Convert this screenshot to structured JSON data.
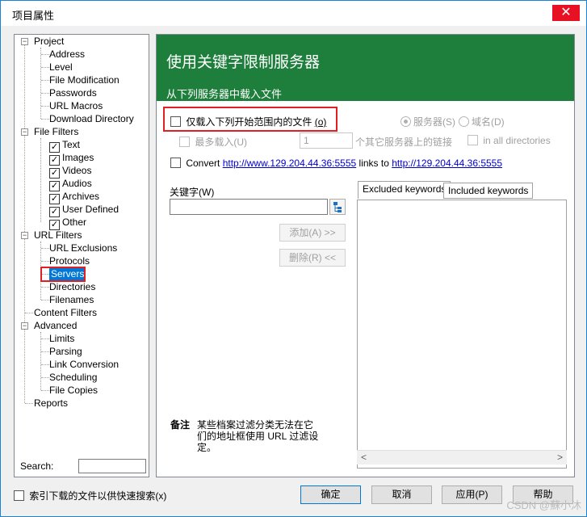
{
  "window": {
    "title": "项目属性",
    "close_glyph": "✕"
  },
  "tree": {
    "items": [
      {
        "label": "Project"
      },
      {
        "label": "Address"
      },
      {
        "label": "Level"
      },
      {
        "label": "File Modification"
      },
      {
        "label": "Passwords"
      },
      {
        "label": "URL Macros"
      },
      {
        "label": "Download Directory"
      },
      {
        "label": "File Filters"
      },
      {
        "label": "Text"
      },
      {
        "label": "Images"
      },
      {
        "label": "Videos"
      },
      {
        "label": "Audios"
      },
      {
        "label": "Archives"
      },
      {
        "label": "User Defined"
      },
      {
        "label": "Other"
      },
      {
        "label": "URL Filters"
      },
      {
        "label": "URL Exclusions"
      },
      {
        "label": "Protocols"
      },
      {
        "label": "Servers"
      },
      {
        "label": "Directories"
      },
      {
        "label": "Filenames"
      },
      {
        "label": "Content Filters"
      },
      {
        "label": "Advanced"
      },
      {
        "label": "Limits"
      },
      {
        "label": "Parsing"
      },
      {
        "label": "Link Conversion"
      },
      {
        "label": "Scheduling"
      },
      {
        "label": "File Copies"
      },
      {
        "label": "Reports"
      }
    ],
    "search_label": "Search:",
    "search_value": ""
  },
  "panel": {
    "title": "使用关键字限制服务器",
    "subtitle": "从下列服务器中载入文件",
    "only_load_label": "仅载入下列开始范围内的文件",
    "only_load_accel": "(o)",
    "radio_server": "服务器(S)",
    "radio_domain": "域名(D)",
    "max_load_label": "最多载入(U)",
    "max_load_value": "1",
    "other_servers_label": "个其它服务器上的链接",
    "in_all_dirs_label": "in all directories",
    "convert_label": "Convert",
    "convert_from": "http://www.129.204.44.36:5555",
    "convert_middle": "links to",
    "convert_to": "http://129.204.44.36:5555",
    "keyword_label": "关键字(W)",
    "keyword_value": "",
    "add_button": "添加(A) >>",
    "remove_button": "删除(R) <<",
    "tab_excluded": "Excluded keywords",
    "tab_included": "Included keywords",
    "note_label": "备注",
    "note_text_1": "某些档案过滤分类无法在它",
    "note_text_2": "们的地址框使用 URL 过滤设",
    "note_text_3": "定。",
    "scroll_left": "<",
    "scroll_right": ">"
  },
  "footer": {
    "index_label": "索引下载的文件以供快速搜索(x)",
    "ok": "确定",
    "cancel": "取消",
    "apply": "应用(P)",
    "help": "帮助"
  },
  "watermark": "CSDN @蘇小沐",
  "check_glyph": "✓"
}
